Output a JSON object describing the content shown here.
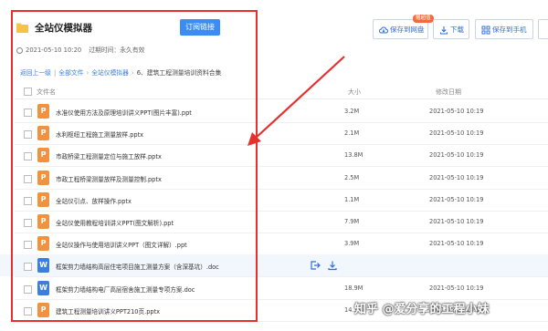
{
  "share": {
    "title": "全站仪模拟器",
    "subscribe_label": "订阅链接",
    "created": "2021-05-10 10:20",
    "expire_label": "过期时间：永久有效"
  },
  "actions": {
    "save_netdisk": "保存到网盘",
    "badge": "赠超值",
    "download": "下载",
    "save_phone": "保存到手机"
  },
  "breadcrumb": {
    "back": "返回上一级",
    "all_files": "全部文件",
    "folder": "全站仪模拟器",
    "current": "6、建筑工程测量培训资料合集"
  },
  "columns": {
    "name": "文件名",
    "size": "大小",
    "date": "修改日期"
  },
  "files": [
    {
      "type": "P",
      "name": "水准仪使用方法及原理培训讲义PPT(图片丰富).ppt",
      "size": "3.2M",
      "date": "2021-05-10 10:19"
    },
    {
      "type": "P",
      "name": "水利枢纽工程施工测量放样.pptx",
      "size": "2.1M",
      "date": "2021-05-10 10:19"
    },
    {
      "type": "P",
      "name": "市政桥梁工程测量定位与施工放样.pptx",
      "size": "13.8M",
      "date": "2021-05-10 10:19"
    },
    {
      "type": "P",
      "name": "市政工程桥梁测量放样及测量控制.pptx",
      "size": "2.5M",
      "date": "2021-05-10 10:19"
    },
    {
      "type": "P",
      "name": "全站仪引点、放样操作.pptx",
      "size": "1.1M",
      "date": "2021-05-10 10:19"
    },
    {
      "type": "P",
      "name": "全站仪使用教程培训讲义PPT(图文解析).ppt",
      "size": "7.9M",
      "date": "2021-05-10 10:19"
    },
    {
      "type": "P",
      "name": "全站仪操作与使用培训讲义PPT（图文详解）.ppt",
      "size": "3.9M",
      "date": "2021-05-10 10:19"
    },
    {
      "type": "W",
      "name": "框架剪力墙结构高层住宅项目施工测量方案（含深基坑）.doc",
      "size": "",
      "date": ""
    },
    {
      "type": "W",
      "name": "框架剪力墙结构电厂高层宿舍施工测量专项方案.doc",
      "size": "18.9M",
      "date": "2021-05-10 10:19"
    },
    {
      "type": "P",
      "name": "建筑工程测量培训讲义PPT210页.pptx",
      "size": "14.3M",
      "date": "2021-05-10 10:19"
    }
  ],
  "watermark": "知乎 @爱分享的工程小妹",
  "colors": {
    "accent": "#3b8cf5",
    "highlight_box": "#e5302d",
    "ppt_icon": "#f3913e",
    "doc_icon": "#3a7fe0"
  }
}
